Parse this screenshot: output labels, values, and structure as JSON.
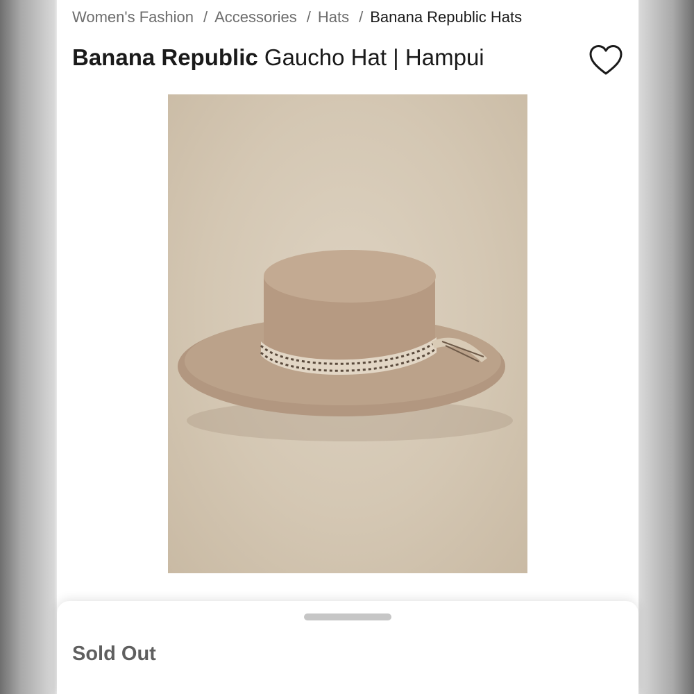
{
  "breadcrumb": {
    "items": [
      {
        "label": "Women's Fashion"
      },
      {
        "label": "Accessories"
      },
      {
        "label": "Hats"
      },
      {
        "label": "Banana Republic Hats"
      }
    ],
    "separator": "/"
  },
  "product": {
    "brand": "Banana Republic",
    "name": "Gaucho Hat | Hampui",
    "image_icon": "product-photo"
  },
  "favorite": {
    "icon": "heart-outline-icon"
  },
  "sheet": {
    "status": "Sold Out"
  },
  "colors": {
    "hat": "#b59b83",
    "background_photo": "#d6cab7",
    "text_primary": "#1a1a1a",
    "text_secondary": "#6d6d6d"
  }
}
